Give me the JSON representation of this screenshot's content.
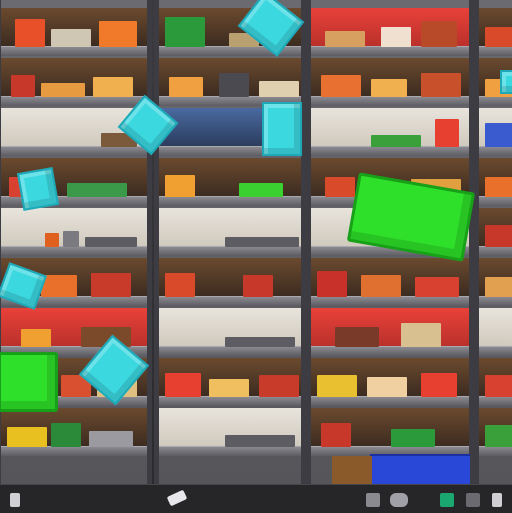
{
  "scene": {
    "columns": 4,
    "rows_per_column": 9,
    "colors": {
      "frame": "#5c5c62",
      "shelf_board": "#8a8a90",
      "cube": "#3cd8e0",
      "green_block": "#2ee02a",
      "red_panel": "#e8413a",
      "floor_blue": "#2a48d8"
    }
  },
  "bottom_bar": {
    "icons": [
      "mug-icon",
      "gamepad-icon",
      "grid-icon",
      "square-icon",
      "letter-p-icon"
    ]
  }
}
